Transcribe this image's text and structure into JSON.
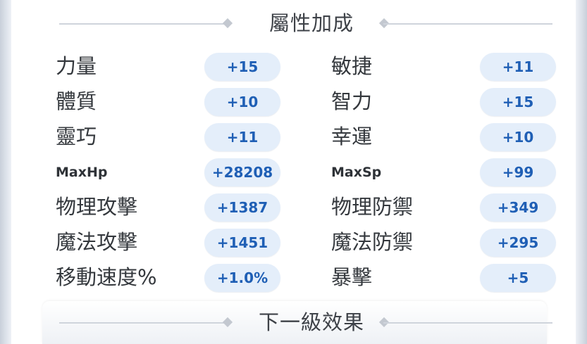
{
  "attribute_bonus": {
    "title": "屬性加成",
    "rows": [
      {
        "left": {
          "label": "力量",
          "value": "+15"
        },
        "right": {
          "label": "敏捷",
          "value": "+11"
        }
      },
      {
        "left": {
          "label": "體質",
          "value": "+10"
        },
        "right": {
          "label": "智力",
          "value": "+15"
        }
      },
      {
        "left": {
          "label": "靈巧",
          "value": "+11"
        },
        "right": {
          "label": "幸運",
          "value": "+10"
        }
      },
      {
        "left": {
          "label": "MaxHp",
          "value": "+28208"
        },
        "right": {
          "label": "MaxSp",
          "value": "+99"
        }
      },
      {
        "left": {
          "label": "物理攻擊",
          "value": "+1387"
        },
        "right": {
          "label": "物理防禦",
          "value": "+349"
        }
      },
      {
        "left": {
          "label": "魔法攻擊",
          "value": "+1451"
        },
        "right": {
          "label": "魔法防禦",
          "value": "+295"
        }
      },
      {
        "left": {
          "label": "移動速度%",
          "value": "+1.0%"
        },
        "right": {
          "label": "暴擊",
          "value": "+5"
        }
      }
    ]
  },
  "next_level": {
    "title": "下一級效果"
  },
  "colors": {
    "pill_background": "#e4eefa",
    "pill_text": "#1f5fb5",
    "label_text": "#34383d"
  }
}
